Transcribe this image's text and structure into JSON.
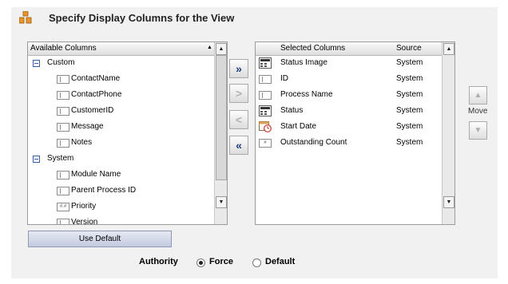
{
  "title": "Specify Display Columns for the View",
  "available": {
    "header": "Available Columns",
    "items": [
      {
        "label": "Custom",
        "group": true
      },
      {
        "label": "ContactName"
      },
      {
        "label": "ContactPhone"
      },
      {
        "label": "CustomerID"
      },
      {
        "label": "Message"
      },
      {
        "label": "Notes"
      },
      {
        "label": "System",
        "group": true
      },
      {
        "label": "Module Name"
      },
      {
        "label": "Parent Process ID"
      },
      {
        "label": "Priority"
      },
      {
        "label": "Version"
      }
    ]
  },
  "transfer": {
    "add_all": "»",
    "add": ">",
    "remove": "<",
    "remove_all": "«"
  },
  "selected": {
    "header_columns": "Selected Columns",
    "header_source": "Source",
    "rows": [
      {
        "label": "Status Image",
        "source": "System",
        "icon": "image-grid-icon"
      },
      {
        "label": "ID",
        "source": "System",
        "icon": "column-icon"
      },
      {
        "label": "Process Name",
        "source": "System",
        "icon": "column-icon"
      },
      {
        "label": "Status",
        "source": "System",
        "icon": "image-grid-icon"
      },
      {
        "label": "Start Date",
        "source": "System",
        "icon": "calendar-clock-icon"
      },
      {
        "label": "Outstanding Count",
        "source": "System",
        "icon": "number-column-icon"
      }
    ]
  },
  "move_label": "Move",
  "use_default_label": "Use Default",
  "authority": {
    "label": "Authority",
    "options": [
      "Force",
      "Default"
    ],
    "selected": "Force"
  }
}
